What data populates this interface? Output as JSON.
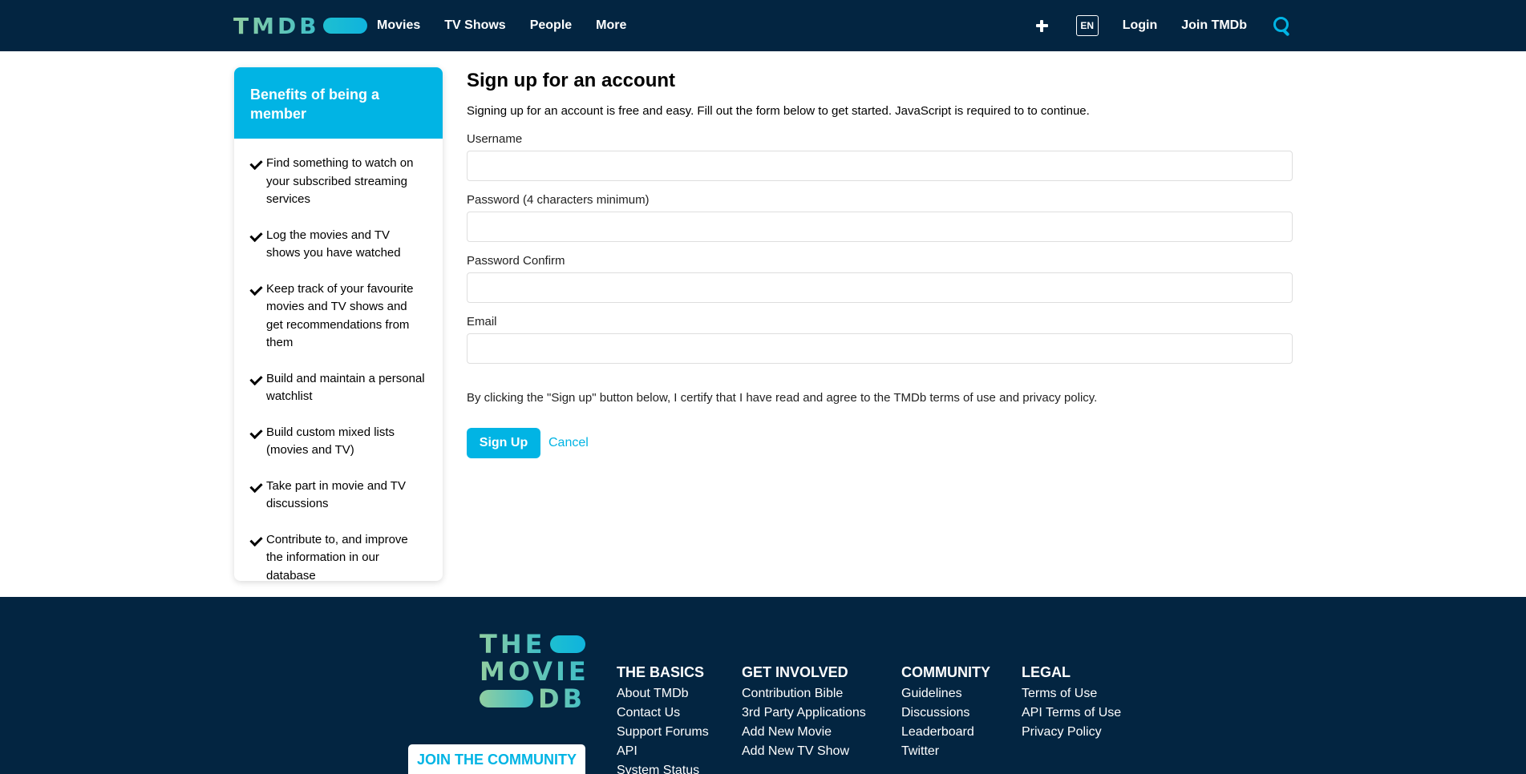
{
  "header": {
    "logo_text": "TMDB",
    "nav": [
      "Movies",
      "TV Shows",
      "People",
      "More"
    ],
    "lang": "EN",
    "login": "Login",
    "join": "Join TMDb"
  },
  "sidebar": {
    "title": "Benefits of being a member",
    "items": [
      "Find something to watch on your subscribed streaming services",
      "Log the movies and TV shows you have watched",
      "Keep track of your favourite movies and TV shows and get recommendations from them",
      "Build and maintain a personal watchlist",
      "Build custom mixed lists (movies and TV)",
      "Take part in movie and TV discussions",
      "Contribute to, and improve the information in our database"
    ]
  },
  "form": {
    "title": "Sign up for an account",
    "intro": "Signing up for an account is free and easy. Fill out the form below to get started. JavaScript is required to to continue.",
    "username_label": "Username",
    "username_value": "",
    "password_label": "Password (4 characters minimum)",
    "password_value": "",
    "confirm_label": "Password Confirm",
    "confirm_value": "",
    "email_label": "Email",
    "email_value": "",
    "terms": "By clicking the \"Sign up\" button below, I certify that I have read and agree to the TMDb terms of use and privacy policy.",
    "signup": "Sign Up",
    "cancel": "Cancel"
  },
  "footer": {
    "logo_lines": [
      "THE",
      "MOVIE",
      "DB"
    ],
    "join_button": "JOIN THE COMMUNITY",
    "columns": [
      {
        "title": "THE BASICS",
        "links": [
          "About TMDb",
          "Contact Us",
          "Support Forums",
          "API",
          "System Status"
        ]
      },
      {
        "title": "GET INVOLVED",
        "links": [
          "Contribution Bible",
          "3rd Party Applications",
          "Add New Movie",
          "Add New TV Show"
        ]
      },
      {
        "title": "COMMUNITY",
        "links": [
          "Guidelines",
          "Discussions",
          "Leaderboard",
          "Twitter"
        ]
      },
      {
        "title": "LEGAL",
        "links": [
          "Terms of Use",
          "API Terms of Use",
          "Privacy Policy"
        ]
      }
    ]
  },
  "colors": {
    "navy": "#032541",
    "accent": "#01b4e4",
    "green": "#90cea1"
  }
}
